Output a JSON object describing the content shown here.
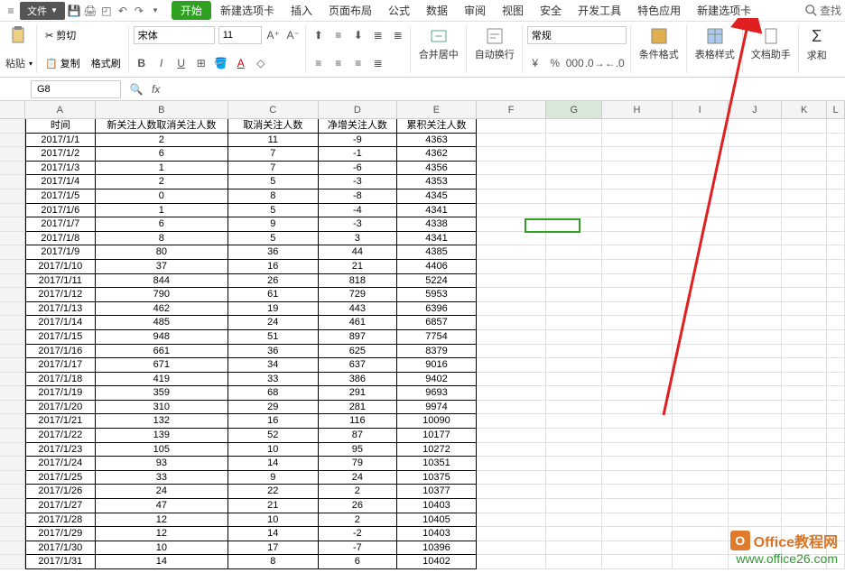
{
  "menubar": {
    "file_label": "文件",
    "tabs": [
      "开始",
      "新建选项卡",
      "插入",
      "页面布局",
      "公式",
      "数据",
      "审阅",
      "视图",
      "安全",
      "开发工具",
      "特色应用",
      "新建选项卡"
    ],
    "active_tab_index": 0,
    "search_label": "查找"
  },
  "ribbon": {
    "paste_label": "粘贴",
    "cut_label": "剪切",
    "copy_label": "复制",
    "format_painter_label": "格式刷",
    "font_name": "宋体",
    "font_size": "11",
    "merge_center_label": "合并居中",
    "wrap_text_label": "自动换行",
    "number_format": "常规",
    "conditional_format_label": "条件格式",
    "table_style_label": "表格样式",
    "doc_assistant_label": "文档助手",
    "sum_label": "求和"
  },
  "formula_bar": {
    "cell_ref": "G8",
    "formula": ""
  },
  "columns": [
    "A",
    "B",
    "C",
    "D",
    "E",
    "F",
    "G",
    "H",
    "I",
    "J",
    "K",
    "L"
  ],
  "headers": [
    "时间",
    "新关注人数取消关注人数",
    "取消关注人数",
    "净增关注人数",
    "累积关注人数"
  ],
  "rows": [
    [
      "2017/1/1",
      "2",
      "11",
      "-9",
      "4363"
    ],
    [
      "2017/1/2",
      "6",
      "7",
      "-1",
      "4362"
    ],
    [
      "2017/1/3",
      "1",
      "7",
      "-6",
      "4356"
    ],
    [
      "2017/1/4",
      "2",
      "5",
      "-3",
      "4353"
    ],
    [
      "2017/1/5",
      "0",
      "8",
      "-8",
      "4345"
    ],
    [
      "2017/1/6",
      "1",
      "5",
      "-4",
      "4341"
    ],
    [
      "2017/1/7",
      "6",
      "9",
      "-3",
      "4338"
    ],
    [
      "2017/1/8",
      "8",
      "5",
      "3",
      "4341"
    ],
    [
      "2017/1/9",
      "80",
      "36",
      "44",
      "4385"
    ],
    [
      "2017/1/10",
      "37",
      "16",
      "21",
      "4406"
    ],
    [
      "2017/1/11",
      "844",
      "26",
      "818",
      "5224"
    ],
    [
      "2017/1/12",
      "790",
      "61",
      "729",
      "5953"
    ],
    [
      "2017/1/13",
      "462",
      "19",
      "443",
      "6396"
    ],
    [
      "2017/1/14",
      "485",
      "24",
      "461",
      "6857"
    ],
    [
      "2017/1/15",
      "948",
      "51",
      "897",
      "7754"
    ],
    [
      "2017/1/16",
      "661",
      "36",
      "625",
      "8379"
    ],
    [
      "2017/1/17",
      "671",
      "34",
      "637",
      "9016"
    ],
    [
      "2017/1/18",
      "419",
      "33",
      "386",
      "9402"
    ],
    [
      "2017/1/19",
      "359",
      "68",
      "291",
      "9693"
    ],
    [
      "2017/1/20",
      "310",
      "29",
      "281",
      "9974"
    ],
    [
      "2017/1/21",
      "132",
      "16",
      "116",
      "10090"
    ],
    [
      "2017/1/22",
      "139",
      "52",
      "87",
      "10177"
    ],
    [
      "2017/1/23",
      "105",
      "10",
      "95",
      "10272"
    ],
    [
      "2017/1/24",
      "93",
      "14",
      "79",
      "10351"
    ],
    [
      "2017/1/25",
      "33",
      "9",
      "24",
      "10375"
    ],
    [
      "2017/1/26",
      "24",
      "22",
      "2",
      "10377"
    ],
    [
      "2017/1/27",
      "47",
      "21",
      "26",
      "10403"
    ],
    [
      "2017/1/28",
      "12",
      "10",
      "2",
      "10405"
    ],
    [
      "2017/1/29",
      "12",
      "14",
      "-2",
      "10403"
    ],
    [
      "2017/1/30",
      "10",
      "17",
      "-7",
      "10396"
    ],
    [
      "2017/1/31",
      "14",
      "8",
      "6",
      "10402"
    ]
  ],
  "watermark": {
    "title": "Office教程网",
    "url": "www.office26.com"
  }
}
